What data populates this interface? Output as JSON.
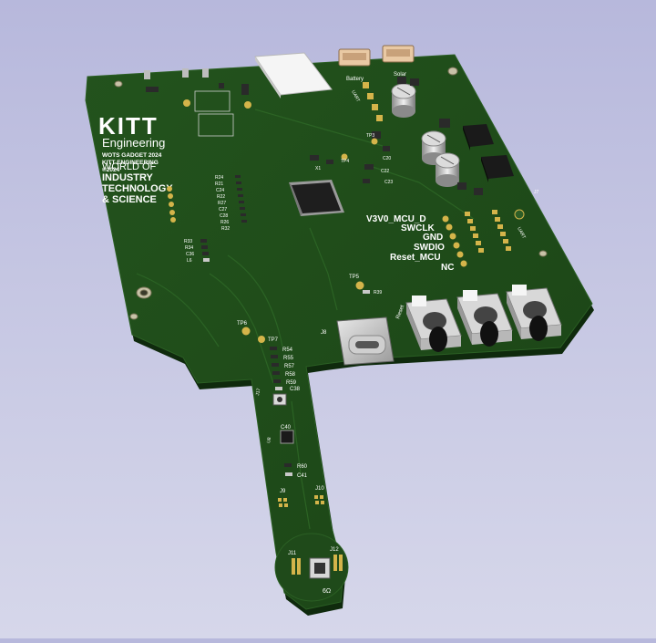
{
  "brand": {
    "logo_title": "KITT",
    "logo_subtitle": "Engineering",
    "info_lines": [
      "WOTS GADGET 2024",
      "KITT ENGINEERING",
      "©2024"
    ],
    "world_lines": [
      "WORLD OF",
      "INDUSTRY",
      "TECHNOLOGY",
      "& SCIENCE"
    ]
  },
  "connectors": {
    "battery": "Battery",
    "solar": "Solar"
  },
  "debug_header": {
    "pins": [
      "V3V0_MCU_D",
      "SWCLK",
      "GND",
      "SWDIO",
      "Reset_MCU",
      "NC"
    ]
  },
  "labels": {
    "usb": "J8",
    "tp5": "TP5",
    "tp6": "TP6",
    "tp7": "TP7",
    "tp3": "TP3",
    "tp4": "TP4",
    "r39": "R39",
    "r54_59": [
      "R54",
      "R55",
      "R57",
      "R58",
      "R59"
    ],
    "c38": "C38",
    "j7": "J7",
    "c40": "C40",
    "u8": "U8",
    "r60": "R60",
    "c41": "C41",
    "j9": "J9",
    "j10": "J10",
    "j11": "J11",
    "j12": "J12",
    "sensor_text": "6Ω",
    "r33_group": [
      "R33",
      "R34",
      "C36",
      "L6"
    ],
    "left_column": [
      "R24",
      "R21",
      "C24",
      "R22",
      "R27",
      "C27",
      "C28",
      "R26",
      "R32"
    ],
    "right_caps": [
      "C19",
      "C25",
      "C26",
      "C16"
    ],
    "x1": "X1",
    "c22": "C22",
    "c23": "C23",
    "c20": "C20",
    "uart": "UART",
    "reset": "Reset"
  },
  "colors": {
    "pcb": "#1f4a1a",
    "pcb_edge": "#0f2a0d",
    "silk": "#ffffff",
    "pad": "#d4b44a"
  }
}
